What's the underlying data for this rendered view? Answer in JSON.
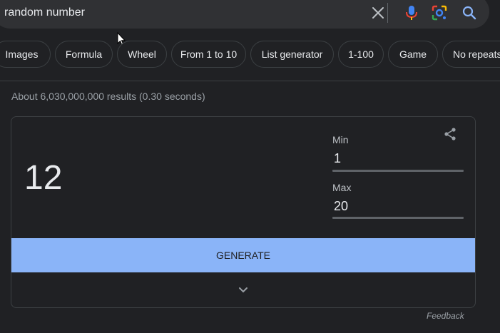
{
  "search": {
    "query": "random number"
  },
  "chips": [
    {
      "label": "Images"
    },
    {
      "label": "Formula"
    },
    {
      "label": "Wheel"
    },
    {
      "label": "From 1 to 10"
    },
    {
      "label": "List generator"
    },
    {
      "label": "1-100"
    },
    {
      "label": "Game"
    },
    {
      "label": "No repeats"
    }
  ],
  "results_stats": "About 6,030,000,000 results (0.30 seconds)",
  "widget": {
    "result": "12",
    "min_label": "Min",
    "min_value": "1",
    "max_label": "Max",
    "max_value": "20",
    "generate_label": "GENERATE"
  },
  "feedback_label": "Feedback",
  "colors": {
    "background": "#202124",
    "searchbar": "#303134",
    "accent": "#8ab4f8"
  },
  "icons": [
    "clear-icon",
    "mic-icon",
    "lens-icon",
    "search-icon",
    "share-icon",
    "chevron-down-icon",
    "mouse-pointer-icon"
  ]
}
